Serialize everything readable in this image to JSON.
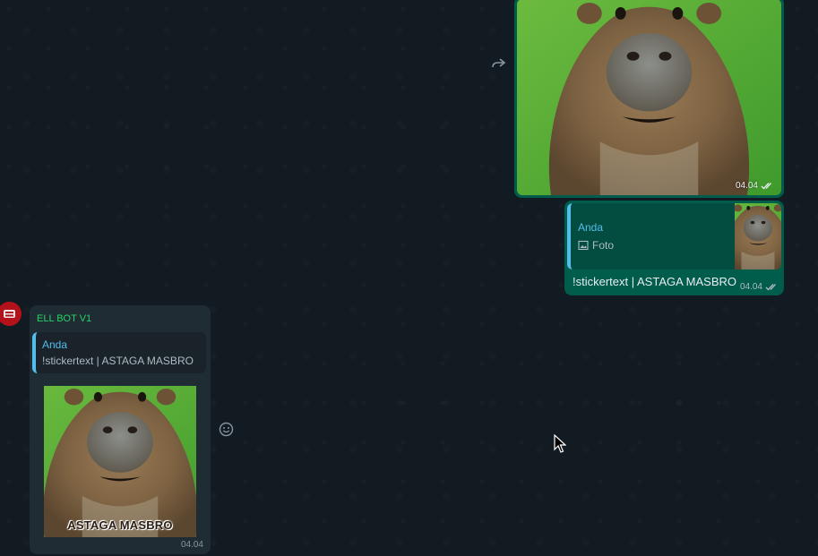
{
  "messages": {
    "outgoing_image": {
      "time": "04.04",
      "status_icon": "double-check-icon"
    },
    "outgoing_reply": {
      "quote_author": "Anda",
      "quote_media_label": "Foto",
      "quote_media_icon": "image-icon",
      "text": "!stickertext | ASTAGA MASBRO",
      "time": "04.04",
      "status_icon": "double-check-icon"
    },
    "incoming_bot": {
      "sender": "ELL BOT V1",
      "quote_author": "Anda",
      "quote_text": "!stickertext | ASTAGA MASBRO",
      "sticker_caption": "ASTAGA MASBRO",
      "time": "04.04"
    }
  },
  "icons": {
    "forward": "forward-icon",
    "emoji": "emoji-icon"
  },
  "colors": {
    "background": "#111b21",
    "outgoing_bubble": "#005c4b",
    "incoming_bubble": "#202c33",
    "quote_bar": "#53bdeb",
    "sender_name": "#25d366",
    "read_ticks": "#e9edef"
  }
}
